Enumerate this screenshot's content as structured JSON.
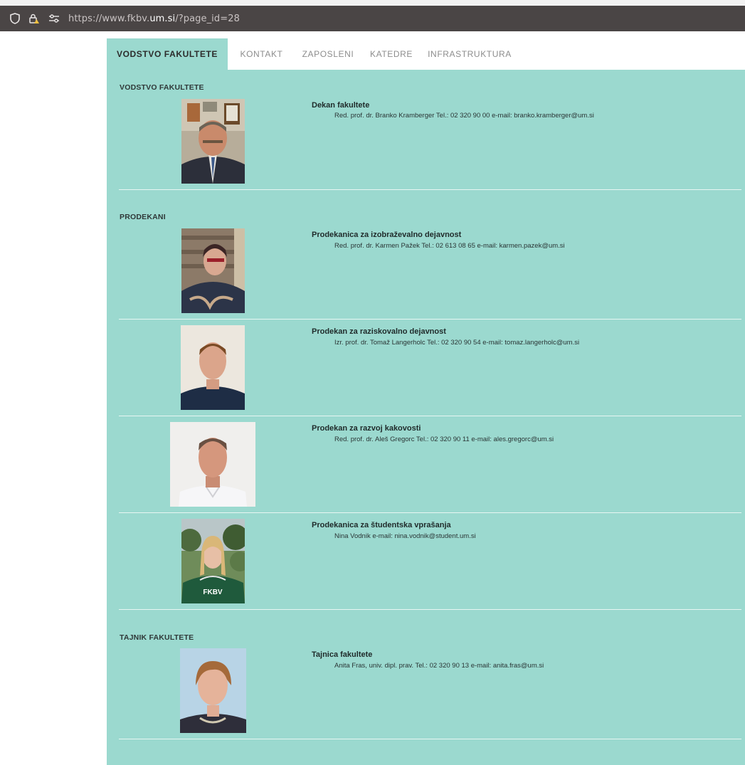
{
  "browser": {
    "url_prefix": "https://www.fkbv.",
    "url_host": "um.si",
    "url_suffix": "/?page_id=28"
  },
  "tabs": [
    {
      "label": "VODSTVO FAKULTETE",
      "active": true
    },
    {
      "label": "KONTAKT",
      "active": false
    },
    {
      "label": "ZAPOSLENI",
      "active": false
    },
    {
      "label": "KATEDRE",
      "active": false
    },
    {
      "label": "INFRASTRUKTURA",
      "active": false
    }
  ],
  "sections": {
    "vodstvo": "VODSTVO FAKULTETE",
    "prodekani": "PRODEKANI",
    "tajnik": "TAJNIK FAKULTETE"
  },
  "people": [
    {
      "role": "Dekan fakultete",
      "info": "Red. prof. dr. Branko Kramberger Tel.: 02 320 90 00 e-mail: branko.kramberger@um.si"
    },
    {
      "role": "Prodekanica za izobraževalno dejavnost",
      "info": "Red. prof. dr. Karmen Pažek Tel.: 02 613 08 65 e-mail: karmen.pazek@um.si"
    },
    {
      "role": "Prodekan za raziskovalno dejavnost",
      "info": "Izr. prof. dr. Tomaž Langerholc Tel.: 02 320 90 54 e-mail: tomaz.langerholc@um.si"
    },
    {
      "role": "Prodekan za razvoj kakovosti",
      "info": "Red. prof. dr. Aleš Gregorc Tel.: 02 320 90 11 e-mail: ales.gregorc@um.si"
    },
    {
      "role": "Prodekanica za študentska vprašanja",
      "info": "Nina Vodnik e-mail: nina.vodnik@student.um.si",
      "shirt_text": "FKBV"
    },
    {
      "role": "Tajnica fakultete",
      "info": "Anita Fras, univ. dipl. prav. Tel.: 02 320 90 13 e-mail: anita.fras@um.si"
    }
  ]
}
